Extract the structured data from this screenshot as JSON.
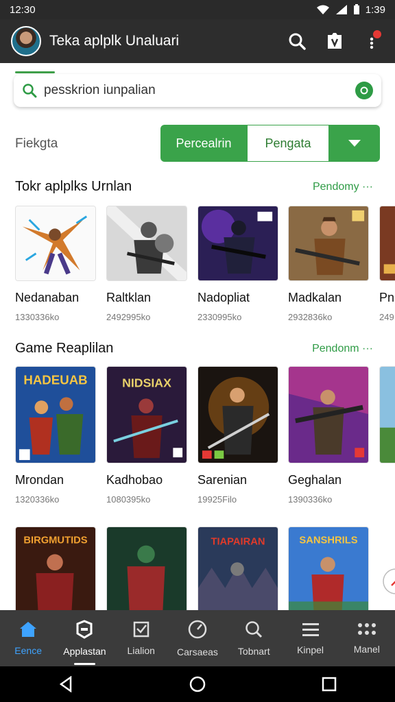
{
  "status_bar": {
    "time_left": "12:30",
    "time_right": "1:39"
  },
  "app_bar": {
    "title": "Teka aplplk Unaluari"
  },
  "search": {
    "value": "pesskrion iunpalian"
  },
  "filter": {
    "label": "Fiekgta",
    "buttons": [
      "Percealrin",
      "Pengata"
    ]
  },
  "sections": [
    {
      "title": "Tokr aplplks Urnlan",
      "more": "Pendomy ···",
      "items": [
        {
          "name": "Nedanaban",
          "meta": "1330336ko"
        },
        {
          "name": "Raltklan",
          "meta": "2492995ko"
        },
        {
          "name": "Nadopliat",
          "meta": "2330995ko"
        },
        {
          "name": "Madkalan",
          "meta": "2932836ko"
        },
        {
          "name": "Pn",
          "meta": "249"
        }
      ]
    },
    {
      "title": "Game Reaplilan",
      "more": "Pendonm ···",
      "items": [
        {
          "name": "Mrondan",
          "meta": "1320336ko"
        },
        {
          "name": "Kadhobao",
          "meta": "1080395ko"
        },
        {
          "name": "Sarenian",
          "meta": "19925Filo"
        },
        {
          "name": "Geghalan",
          "meta": "1390336ko"
        }
      ]
    },
    {
      "title": "",
      "more": "",
      "items": [
        {
          "name": "BIRGMUTIDS",
          "meta": ""
        },
        {
          "name": "",
          "meta": ""
        },
        {
          "name": "TIAPAIRAN",
          "meta": ""
        },
        {
          "name": "SANSHRILS",
          "meta": ""
        }
      ]
    }
  ],
  "posters": [
    "HADEUAB",
    "NIDSIAX"
  ],
  "bottom_nav": [
    {
      "label": "Eence",
      "icon": "home-icon"
    },
    {
      "label": "Applastan",
      "icon": "apps-badge-icon"
    },
    {
      "label": "Lialion",
      "icon": "check-box-icon"
    },
    {
      "label": "Carsaeas",
      "icon": "gauge-icon"
    },
    {
      "label": "Tobnart",
      "icon": "search-icon"
    },
    {
      "label": "Kinpel",
      "icon": "menu-icon"
    },
    {
      "label": "Manel",
      "icon": "grid-icon"
    }
  ],
  "colors": {
    "accent_green": "#3aa34a",
    "app_bar": "#2d2d2d",
    "nav_active": "#3ea3ff"
  }
}
